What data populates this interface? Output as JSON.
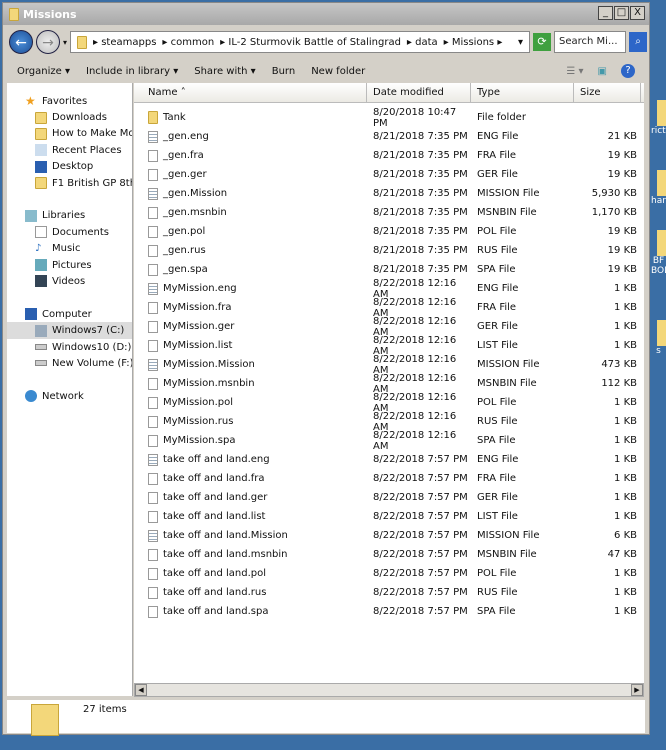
{
  "window": {
    "title": "Missions",
    "min": "_",
    "max": "□",
    "close": "X"
  },
  "address": {
    "crumbs": [
      "steamapps",
      "common",
      "IL-2 Sturmovik Battle of Stalingrad",
      "data",
      "Missions"
    ],
    "search_placeholder": "Search Mi..."
  },
  "toolbar": {
    "organize": "Organize ▾",
    "include": "Include in library ▾",
    "share": "Share with ▾",
    "burn": "Burn",
    "new_folder": "New folder"
  },
  "nav": {
    "favorites": "Favorites",
    "fav_items": [
      "Downloads",
      "How to Make Mone",
      "Recent Places",
      "Desktop",
      "F1 British GP 8th Ju"
    ],
    "libraries": "Libraries",
    "lib_items": [
      "Documents",
      "Music",
      "Pictures",
      "Videos"
    ],
    "computer": "Computer",
    "comp_items": [
      "Windows7 (C:)",
      "Windows10 (D:)",
      "New Volume (F:)"
    ],
    "network": "Network"
  },
  "columns": [
    "Name",
    "Date modified",
    "Type",
    "Size"
  ],
  "files": [
    [
      "Tank",
      "8/20/2018 10:47 PM",
      "File folder",
      ""
    ],
    [
      "_gen.eng",
      "8/21/2018 7:35 PM",
      "ENG File",
      "21 KB"
    ],
    [
      "_gen.fra",
      "8/21/2018 7:35 PM",
      "FRA File",
      "19 KB"
    ],
    [
      "_gen.ger",
      "8/21/2018 7:35 PM",
      "GER File",
      "19 KB"
    ],
    [
      "_gen.Mission",
      "8/21/2018 7:35 PM",
      "MISSION File",
      "5,930 KB"
    ],
    [
      "_gen.msnbin",
      "8/21/2018 7:35 PM",
      "MSNBIN File",
      "1,170 KB"
    ],
    [
      "_gen.pol",
      "8/21/2018 7:35 PM",
      "POL File",
      "19 KB"
    ],
    [
      "_gen.rus",
      "8/21/2018 7:35 PM",
      "RUS File",
      "19 KB"
    ],
    [
      "_gen.spa",
      "8/21/2018 7:35 PM",
      "SPA File",
      "19 KB"
    ],
    [
      "MyMission.eng",
      "8/22/2018 12:16 AM",
      "ENG File",
      "1 KB"
    ],
    [
      "MyMission.fra",
      "8/22/2018 12:16 AM",
      "FRA File",
      "1 KB"
    ],
    [
      "MyMission.ger",
      "8/22/2018 12:16 AM",
      "GER File",
      "1 KB"
    ],
    [
      "MyMission.list",
      "8/22/2018 12:16 AM",
      "LIST File",
      "1 KB"
    ],
    [
      "MyMission.Mission",
      "8/22/2018 12:16 AM",
      "MISSION File",
      "473 KB"
    ],
    [
      "MyMission.msnbin",
      "8/22/2018 12:16 AM",
      "MSNBIN File",
      "112 KB"
    ],
    [
      "MyMission.pol",
      "8/22/2018 12:16 AM",
      "POL File",
      "1 KB"
    ],
    [
      "MyMission.rus",
      "8/22/2018 12:16 AM",
      "RUS File",
      "1 KB"
    ],
    [
      "MyMission.spa",
      "8/22/2018 12:16 AM",
      "SPA File",
      "1 KB"
    ],
    [
      "take off and land.eng",
      "8/22/2018 7:57 PM",
      "ENG File",
      "1 KB"
    ],
    [
      "take off and land.fra",
      "8/22/2018 7:57 PM",
      "FRA File",
      "1 KB"
    ],
    [
      "take off and land.ger",
      "8/22/2018 7:57 PM",
      "GER File",
      "1 KB"
    ],
    [
      "take off and land.list",
      "8/22/2018 7:57 PM",
      "LIST File",
      "1 KB"
    ],
    [
      "take off and land.Mission",
      "8/22/2018 7:57 PM",
      "MISSION File",
      "6 KB"
    ],
    [
      "take off and land.msnbin",
      "8/22/2018 7:57 PM",
      "MSNBIN File",
      "47 KB"
    ],
    [
      "take off and land.pol",
      "8/22/2018 7:57 PM",
      "POL File",
      "1 KB"
    ],
    [
      "take off and land.rus",
      "8/22/2018 7:57 PM",
      "RUS File",
      "1 KB"
    ],
    [
      "take off and land.spa",
      "8/22/2018 7:57 PM",
      "SPA File",
      "1 KB"
    ]
  ],
  "status": {
    "count": "27 items"
  },
  "desktop": [
    "ricto",
    "har",
    "BF BOD",
    "s"
  ]
}
